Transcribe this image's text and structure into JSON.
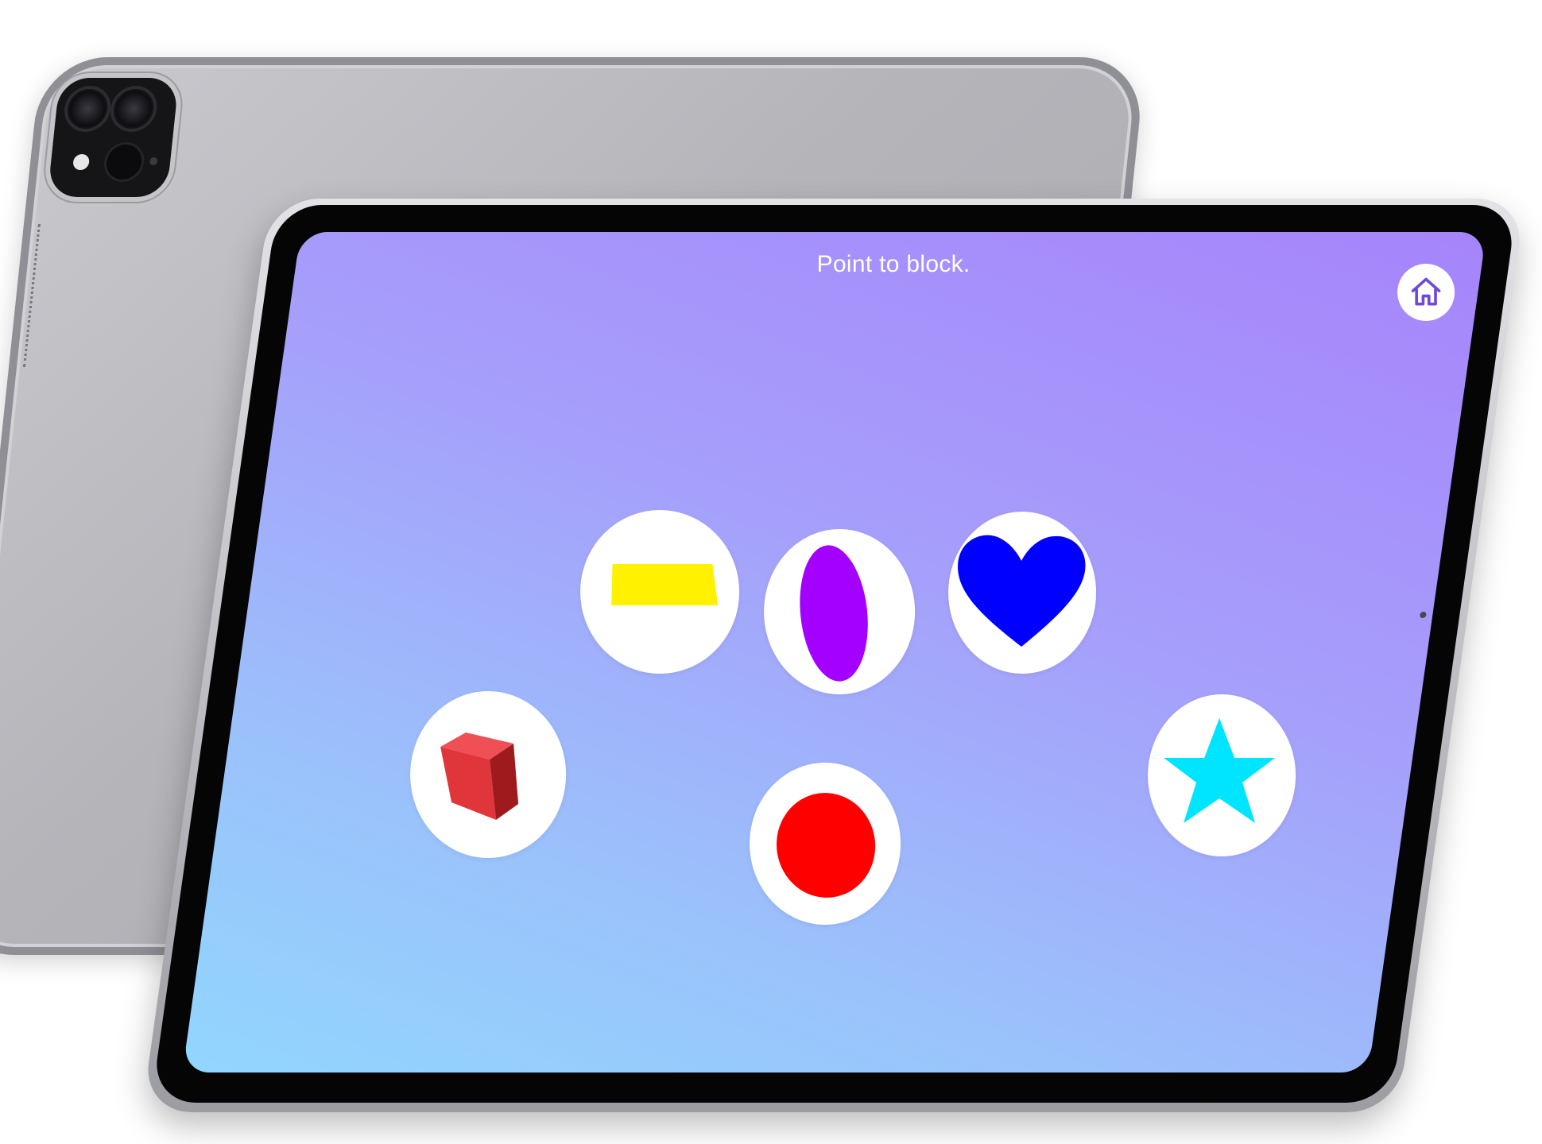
{
  "app": {
    "prompt": "Point to block."
  },
  "colors": {
    "screen_top_right": "#a684fb",
    "screen_bottom_left": "#92d6fe",
    "home_icon": "#6d4bd8",
    "yellow": "#fff100",
    "purple": "#a400ff",
    "blue": "#0000ff",
    "red": "#ff0000",
    "cube_red": "#d9262b",
    "cyan": "#00e5ff"
  },
  "header": {
    "home_icon": "house-icon"
  },
  "choices": [
    {
      "shape": "rectangle",
      "color": "yellow"
    },
    {
      "shape": "oval",
      "color": "purple"
    },
    {
      "shape": "heart",
      "color": "blue"
    },
    {
      "shape": "cube",
      "color": "red"
    },
    {
      "shape": "circle",
      "color": "red"
    },
    {
      "shape": "star",
      "color": "cyan"
    }
  ]
}
